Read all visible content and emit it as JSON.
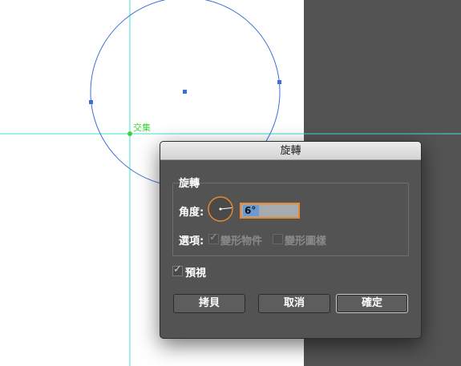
{
  "canvas": {
    "smart_guide_label": "交集",
    "guide_color": "#40e0d0",
    "path_color": "#3b6fd6",
    "point_label_color": "#3ad33a"
  },
  "dialog": {
    "title": "旋轉",
    "group_title": "旋轉",
    "angle_label": "角度:",
    "angle_value": "6°",
    "options_label": "選項:",
    "option_transform_objects": "變形物件",
    "option_transform_patterns": "變形圖樣",
    "preview_label": "預視",
    "copy_button": "拷貝",
    "cancel_button": "取消",
    "ok_button": "確定",
    "accent_color": "#e8892e"
  }
}
